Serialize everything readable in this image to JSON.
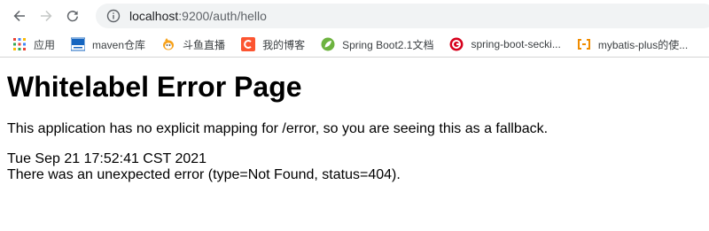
{
  "browser": {
    "url": {
      "host": "localhost",
      "rest": ":9200/auth/hello"
    },
    "icons": {
      "back": "arrow-left-icon",
      "forward": "arrow-right-icon",
      "reload": "reload-icon",
      "site_info": "info-icon"
    },
    "bookmarks": [
      {
        "label": "应用",
        "icon": "apps-grid-icon"
      },
      {
        "label": "maven仓库",
        "icon": "mvn-icon"
      },
      {
        "label": "斗鱼直播",
        "icon": "douyu-icon"
      },
      {
        "label": "我的博客",
        "icon": "csdn-icon"
      },
      {
        "label": "Spring Boot2.1文档",
        "icon": "spring-leaf-icon"
      },
      {
        "label": "spring-boot-secki...",
        "icon": "red-circle-icon"
      },
      {
        "label": "mybatis-plus的使...",
        "icon": "bracket-icon"
      }
    ]
  },
  "page": {
    "title": "Whitelabel Error Page",
    "message": "This application has no explicit mapping for /error, so you are seeing this as a fallback.",
    "timestamp": "Tue Sep 21 17:52:41 CST 2021",
    "error": "There was an unexpected error (type=Not Found, status=404)."
  },
  "colors": {
    "omnibox_bg": "#f1f3f4",
    "icon_gray": "#5f6368"
  }
}
